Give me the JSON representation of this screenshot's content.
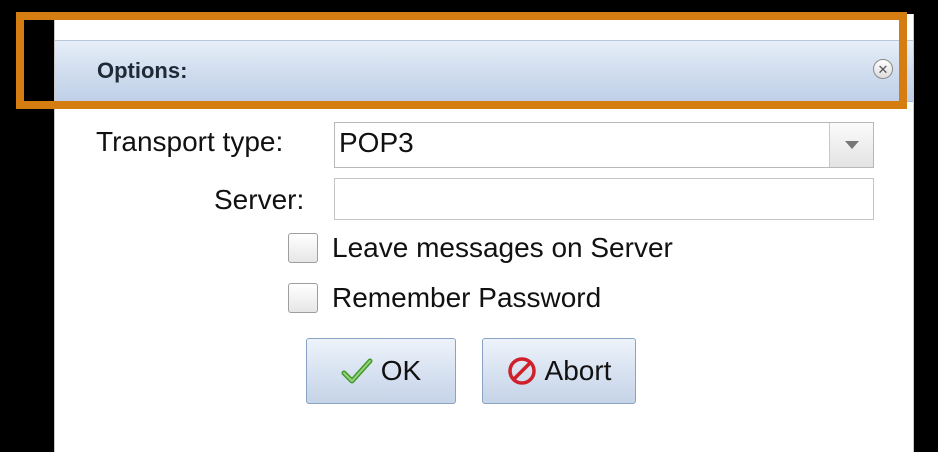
{
  "dialog": {
    "title": "Options:",
    "close_icon": "close-circle-icon"
  },
  "form": {
    "transport_label": "Transport type:",
    "transport_value": "POP3",
    "server_label": "Server:",
    "server_value": "",
    "leave_messages_label": "Leave messages on Server",
    "leave_messages_checked": false,
    "remember_password_label": "Remember Password",
    "remember_password_checked": false
  },
  "buttons": {
    "ok_label": "OK",
    "ok_icon": "checkmark-icon",
    "abort_label": "Abort",
    "abort_icon": "prohibited-icon"
  },
  "colors": {
    "highlight": "#d57d10",
    "titlebar": "#cfdcee",
    "ok_check": "#3f9a2c",
    "abort_red": "#d0202a"
  }
}
